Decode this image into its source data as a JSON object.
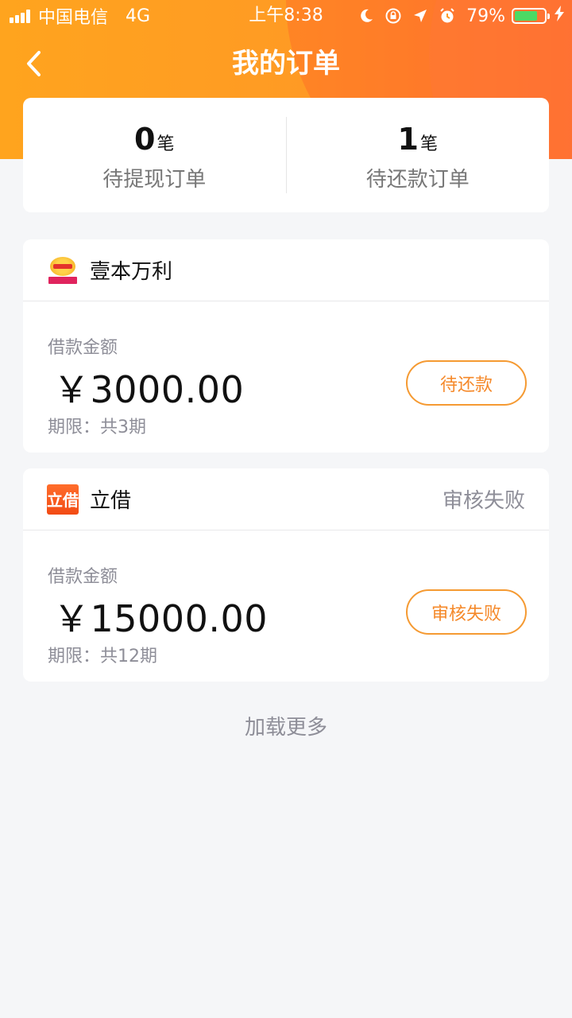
{
  "status_bar": {
    "carrier": "中国电信",
    "network": "4G",
    "time": "上午8:38",
    "battery_percent": "79%",
    "battery_level": 0.79,
    "icons": [
      "moon-icon",
      "rotation-lock-icon",
      "location-arrow-icon",
      "alarm-icon",
      "battery-icon",
      "charging-bolt-icon"
    ]
  },
  "nav": {
    "title": "我的订单",
    "back_icon": "chevron-left-icon"
  },
  "summary": {
    "unit": "笔",
    "withdraw": {
      "count": "0",
      "label": "待提现订单"
    },
    "repay": {
      "count": "1",
      "label": "待还款订单"
    }
  },
  "orders": [
    {
      "provider": "壹本万利",
      "status_text": "",
      "amount_label": "借款金额",
      "amount": "￥3000.00",
      "term": "期限：共3期",
      "action": "待还款"
    },
    {
      "provider": "立借",
      "logo_text": "立借",
      "status_text": "审核失败",
      "amount_label": "借款金额",
      "amount": "￥15000.00",
      "term": "期限：共12期",
      "action": "审核失败"
    }
  ],
  "load_more": "加载更多",
  "colors": {
    "header_orange": "#ffa41e",
    "accent": "#f5892a",
    "muted_text": "#8e8e98",
    "background": "#f5f6f8"
  }
}
